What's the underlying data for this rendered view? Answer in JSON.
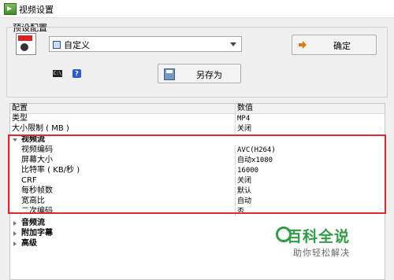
{
  "window": {
    "title": "视频设置"
  },
  "preset": {
    "group_label": "预设配置",
    "selected": "自定义",
    "confirm_label": "确定",
    "saveas_label": "另存为",
    "cmd_icon_text": "C:\\"
  },
  "grid": {
    "header": {
      "name": "配置",
      "value": "数值"
    },
    "rows": [
      {
        "name": "类型",
        "value": "MP4"
      },
      {
        "name": "大小限制 ( MB )",
        "value": "关闭"
      }
    ],
    "video_section": {
      "label": "视频流",
      "rows": [
        {
          "name": "视频编码",
          "value": "AVC(H264)"
        },
        {
          "name": "屏幕大小",
          "value": "自动x1080"
        },
        {
          "name": "比特率 ( KB/秒 )",
          "value": "16000"
        },
        {
          "name": "CRF",
          "value": "关闭"
        },
        {
          "name": "每秒帧数",
          "value": "默认"
        },
        {
          "name": "宽高比",
          "value": "自动"
        },
        {
          "name": "二次编码",
          "value": "否"
        }
      ]
    },
    "audio_section": {
      "label": "音频流"
    },
    "subtitle_section": {
      "label": "附加字幕"
    },
    "advanced_section": {
      "label": "高级"
    }
  },
  "watermark": {
    "title": "百科全说",
    "subtitle": "助你轻松解决"
  },
  "colors": {
    "highlight": "#e5262a",
    "watermark_green": "#2f9e44"
  }
}
